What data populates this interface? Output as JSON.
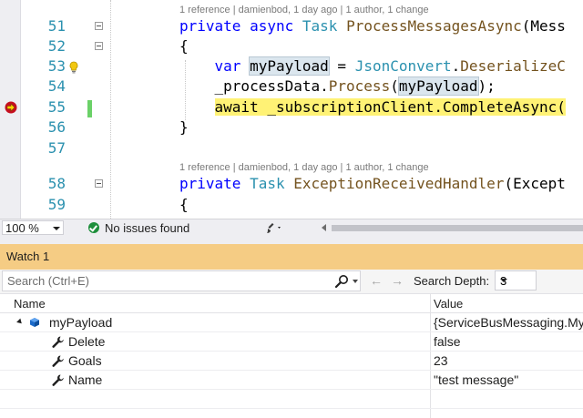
{
  "editor": {
    "lines": [
      {
        "num": "51",
        "segments": [
          {
            "t": "private",
            "c": "kw"
          },
          {
            "t": " "
          },
          {
            "t": "async",
            "c": "kw"
          },
          {
            "t": " "
          },
          {
            "t": "Task",
            "c": "ty"
          },
          {
            "t": " "
          },
          {
            "t": "ProcessMessagesAsync",
            "c": "mt"
          },
          {
            "t": "(Mess"
          }
        ]
      },
      {
        "num": "52",
        "segments": [
          {
            "t": "{"
          }
        ]
      },
      {
        "num": "53",
        "segments": [
          {
            "t": "    "
          },
          {
            "t": "var",
            "c": "kw"
          },
          {
            "t": " "
          },
          {
            "t": "myPayload",
            "c": "hl-var"
          },
          {
            "t": " = "
          },
          {
            "t": "JsonConvert",
            "c": "ty"
          },
          {
            "t": "."
          },
          {
            "t": "DeserializeC",
            "c": "mt"
          }
        ]
      },
      {
        "num": "54",
        "segments": [
          {
            "t": "    _processData."
          },
          {
            "t": "Process",
            "c": "mt"
          },
          {
            "t": "("
          },
          {
            "t": "myPayload",
            "c": "hl-var"
          },
          {
            "t": ");"
          }
        ]
      },
      {
        "num": "55",
        "segments": [
          {
            "t": "    "
          },
          {
            "t": "await _subscriptionClient.CompleteAsync(",
            "c": "cur-stmt"
          }
        ]
      },
      {
        "num": "56",
        "segments": [
          {
            "t": "}"
          }
        ]
      },
      {
        "num": "57",
        "segments": []
      },
      {
        "num": "58",
        "segments": [
          {
            "t": "private",
            "c": "kw"
          },
          {
            "t": " "
          },
          {
            "t": "Task",
            "c": "ty"
          },
          {
            "t": " "
          },
          {
            "t": "ExceptionReceivedHandler",
            "c": "mt"
          },
          {
            "t": "(Except"
          }
        ]
      },
      {
        "num": "59",
        "segments": [
          {
            "t": "{"
          }
        ]
      }
    ],
    "codelens_1": "1 reference | damienbod, 1 day ago | 1 author, 1 change",
    "codelens_2": "1 reference | damienbod, 1 day ago | 1 author, 1 change"
  },
  "status": {
    "zoom": "100 %",
    "issues": "No issues found"
  },
  "watch": {
    "title": "Watch 1",
    "search_placeholder": "Search (Ctrl+E)",
    "back_arrow": "←",
    "forward_arrow": "→",
    "depth_label": "Search Depth:",
    "depth_value": "3",
    "columns": {
      "name": "Name",
      "value": "Value"
    },
    "rows": [
      {
        "name": "myPayload",
        "value": "{ServiceBusMessaging.My"
      },
      {
        "name": "Delete",
        "value": "false"
      },
      {
        "name": "Goals",
        "value": "23"
      },
      {
        "name": "Name",
        "value": "\"test message\""
      }
    ]
  },
  "colors": {
    "watch_title_bg": "#f5cc84",
    "current_statement": "#fff275",
    "line_number": "#2b91af",
    "keyword": "#0000ff",
    "type": "#2b91af"
  }
}
